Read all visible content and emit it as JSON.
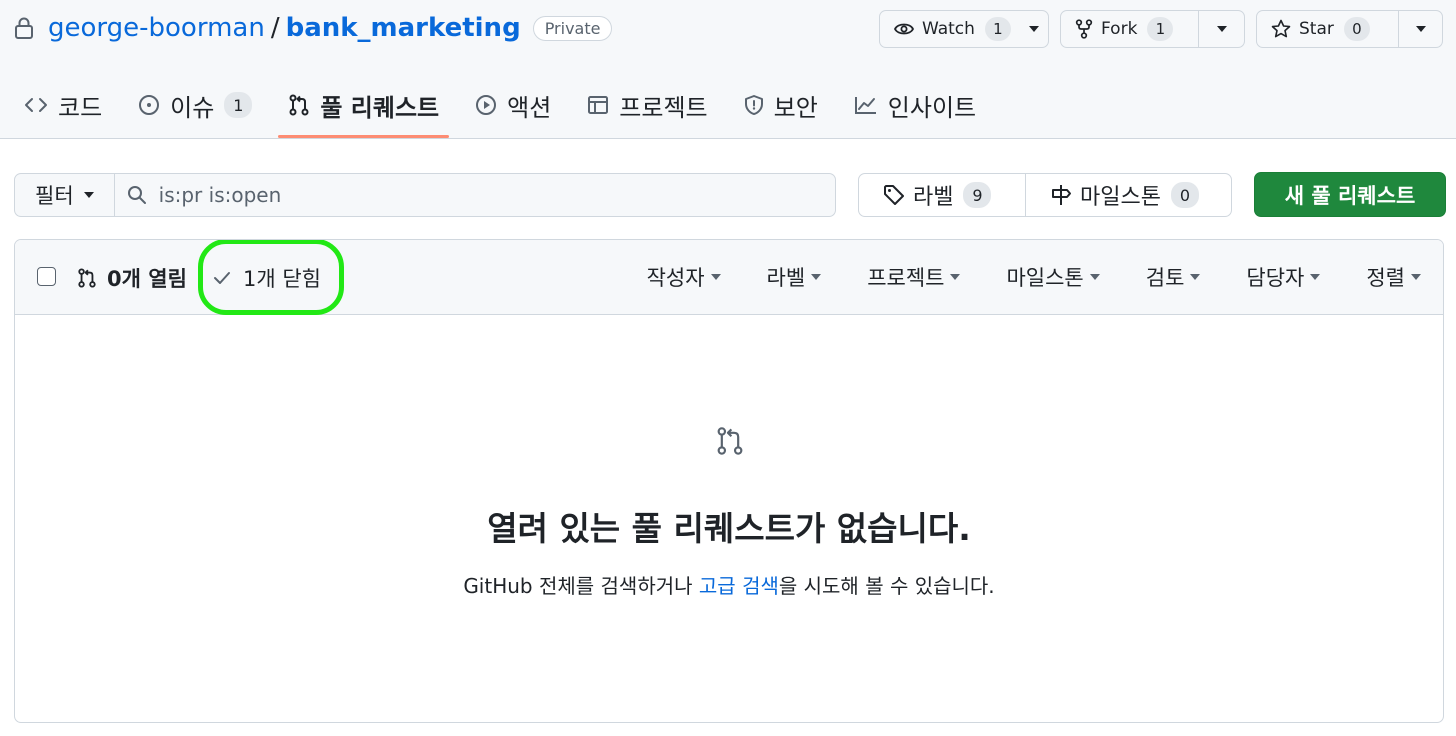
{
  "repo": {
    "owner": "george-boorman",
    "separator": "/",
    "name": "bank_marketing",
    "visibility": "Private"
  },
  "actions": {
    "watch": {
      "label": "Watch",
      "count": "1"
    },
    "fork": {
      "label": "Fork",
      "count": "1"
    },
    "star": {
      "label": "Star",
      "count": "0"
    }
  },
  "tabs": [
    {
      "label": "코드",
      "icon": "code-icon"
    },
    {
      "label": "이슈",
      "icon": "issue-icon",
      "count": "1"
    },
    {
      "label": "풀 리퀘스트",
      "icon": "pull-request-icon",
      "active": true
    },
    {
      "label": "액션",
      "icon": "play-icon"
    },
    {
      "label": "프로젝트",
      "icon": "table-icon"
    },
    {
      "label": "보안",
      "icon": "shield-icon"
    },
    {
      "label": "인사이트",
      "icon": "graph-icon"
    }
  ],
  "filter": {
    "label": "필터",
    "query": "is:pr is:open"
  },
  "labels": {
    "label": "라벨",
    "count": "9"
  },
  "milestones": {
    "label": "마일스톤",
    "count": "0"
  },
  "new_pr": "새 풀 리퀘스트",
  "list": {
    "open_label": "0개 열림",
    "closed_label": "1개 닫힘",
    "menus": [
      "작성자",
      "라벨",
      "프로젝트",
      "마일스톤",
      "검토",
      "담당자",
      "정렬"
    ]
  },
  "empty": {
    "title": "열려 있는 풀 리퀘스트가 없습니다.",
    "desc_before": "GitHub 전체를 검색하거나 ",
    "desc_link": "고급 검색",
    "desc_after": "을 시도해 볼 수 있습니다."
  },
  "colors": {
    "link": "#0969da",
    "primary_button": "#1f883d",
    "active_tab_underline": "#fd8c73",
    "highlight": "#22e815"
  }
}
